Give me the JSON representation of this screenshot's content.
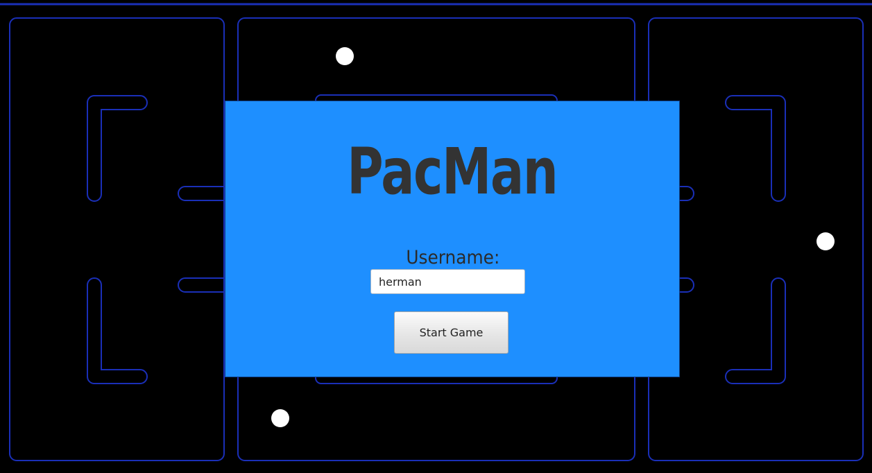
{
  "game": {
    "title": "PacMan"
  },
  "login": {
    "username_label": "Username:",
    "username_value": "herman",
    "start_button_label": "Start Game"
  },
  "colors": {
    "background": "#000000",
    "maze_wall": "#1a2fb8",
    "panel": "#1e8fff",
    "title_text": "#333333",
    "pellet": "#ffffff"
  }
}
